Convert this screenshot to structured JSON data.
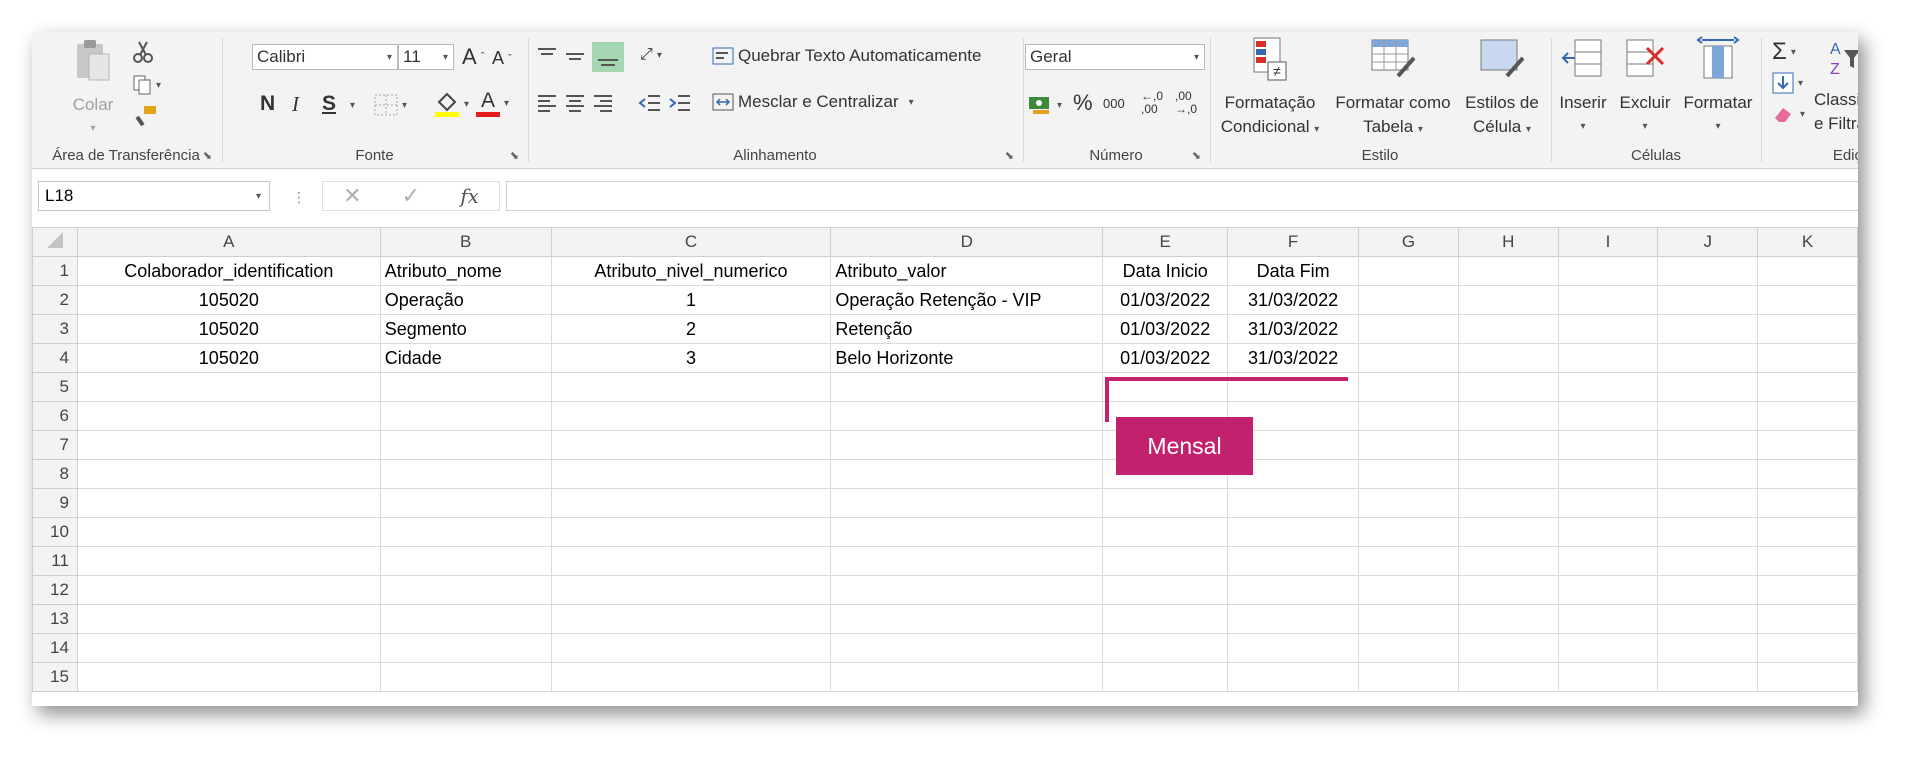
{
  "ribbon": {
    "clipboard": {
      "label": "Área de Transferência",
      "paste_label": "Colar"
    },
    "font": {
      "label": "Fonte",
      "name": "Calibri",
      "size": "11",
      "grow": "A",
      "shrink": "A",
      "bold": "N",
      "italic": "I",
      "underline": "S",
      "font_color_glyph": "A"
    },
    "alignment": {
      "label": "Alinhamento",
      "wrap_text": "Quebrar Texto Automaticamente",
      "merge_center": "Mesclar e Centralizar"
    },
    "number": {
      "label": "Número",
      "format": "Geral",
      "percent": "%",
      "thousands": "000",
      "inc_decimal_top": "←,0",
      "inc_decimal_bottom": ",00",
      "dec_decimal_top": ",00",
      "dec_decimal_bottom": "→,0"
    },
    "styles": {
      "label": "Estilo",
      "conditional_line1": "Formatação",
      "conditional_line2": "Condicional",
      "as_table_line1": "Formatar como",
      "as_table_line2": "Tabela",
      "cell_styles_line1": "Estilos de",
      "cell_styles_line2": "Célula"
    },
    "cells": {
      "label": "Células",
      "insert": "Inserir",
      "delete": "Excluir",
      "format": "Formatar"
    },
    "editing": {
      "label": "Ediç",
      "sort_line1": "Classifica",
      "sort_line2": "e Filtrar"
    }
  },
  "formula_bar": {
    "name_box": "L18",
    "fx": "fx",
    "content": ""
  },
  "sheet": {
    "columns": [
      "A",
      "B",
      "C",
      "D",
      "E",
      "F",
      "G",
      "H",
      "I",
      "J",
      "K"
    ],
    "row_numbers": [
      "1",
      "2",
      "3",
      "4",
      "5",
      "6",
      "7",
      "8",
      "9",
      "10",
      "11",
      "12",
      "13",
      "14",
      "15"
    ],
    "headers": [
      "Colaborador_identification",
      "Atributo_nome",
      "Atributo_nivel_numerico",
      "Atributo_valor",
      "Data Inicio",
      "Data Fim"
    ],
    "rows": [
      [
        "105020",
        "Operação",
        "1",
        "Operação Retenção - VIP",
        "01/03/2022",
        "31/03/2022"
      ],
      [
        "105020",
        "Segmento",
        "2",
        "Retenção",
        "01/03/2022",
        "31/03/2022"
      ],
      [
        "105020",
        "Cidade",
        "3",
        "Belo Horizonte",
        "01/03/2022",
        "31/03/2022"
      ]
    ]
  },
  "annotation": {
    "label": "Mensal",
    "color": "#c2216d"
  }
}
